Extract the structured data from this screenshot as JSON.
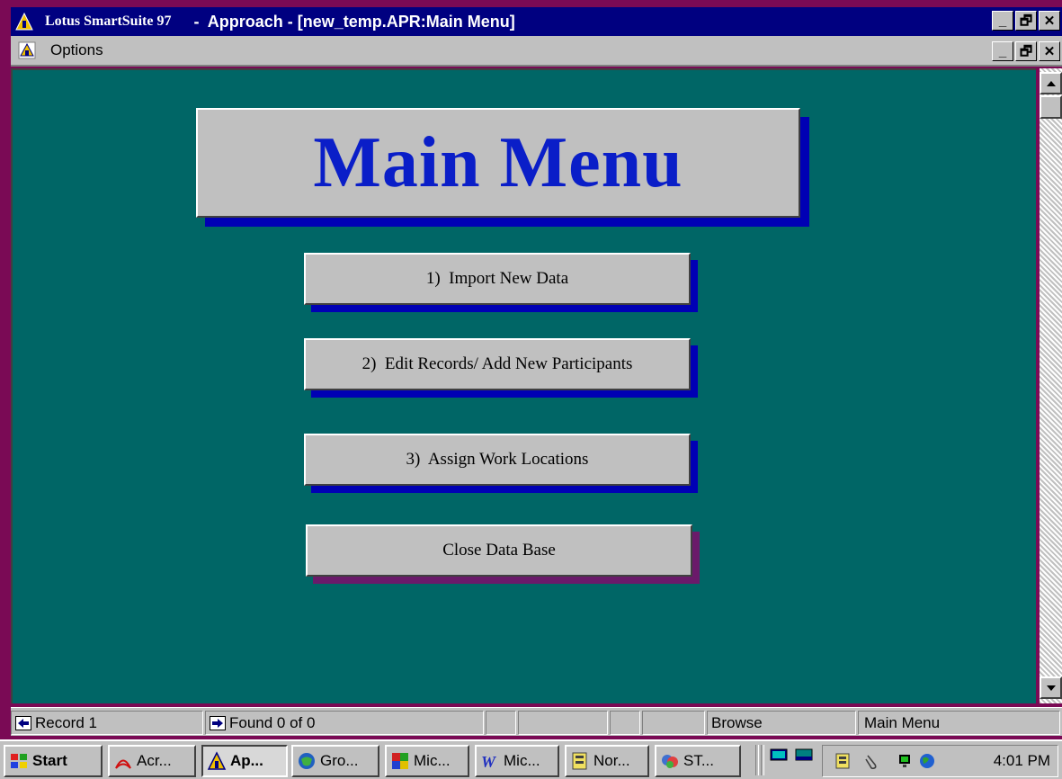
{
  "window": {
    "title_product": "Lotus SmartSuite 97",
    "title_rest": " -  Approach - [new_temp.APR:Main Menu]",
    "btn_min": "_",
    "btn_max": "🗗",
    "btn_close": "✕"
  },
  "menubar": {
    "options_label": "Options"
  },
  "form": {
    "title": "Main Menu",
    "buttons": [
      {
        "label": "1)  Import New Data"
      },
      {
        "label": "2)  Edit Records/ Add New Participants"
      },
      {
        "label": "3)  Assign Work Locations"
      },
      {
        "label": "Close Data Base"
      }
    ],
    "title_color": "#0a1ec8",
    "background_color": "#006666"
  },
  "statusbar": {
    "record": "Record 1",
    "found": "Found 0 of 0",
    "mode": "Browse",
    "view": "Main Menu"
  },
  "taskbar": {
    "start": "Start",
    "tasks": [
      {
        "label": "Acr...",
        "icon": "acrobat-icon"
      },
      {
        "label": "Ap...",
        "icon": "approach-icon",
        "active": true
      },
      {
        "label": "Gro...",
        "icon": "groupwise-icon"
      },
      {
        "label": "Mic...",
        "icon": "access-icon"
      },
      {
        "label": "Mic...",
        "icon": "word-icon"
      },
      {
        "label": "Nor...",
        "icon": "norton-icon"
      },
      {
        "label": "ST...",
        "icon": "st-icon"
      }
    ],
    "clock": "4:01 PM"
  }
}
